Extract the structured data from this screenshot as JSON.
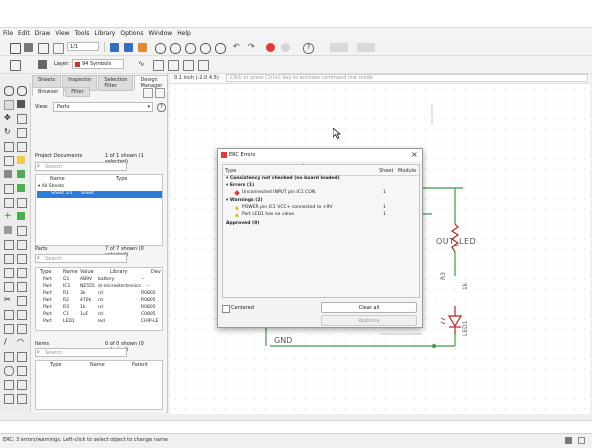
{
  "menu": [
    "File",
    "Edit",
    "Draw",
    "View",
    "Tools",
    "Library",
    "Options",
    "Window",
    "Help"
  ],
  "toolbar": {
    "sheet_value": "1/1",
    "layer_label": "Layer:",
    "layer_value": "94 Symbols",
    "layer_color": "#c0392b",
    "accent_red": "#e53935",
    "accent_blue": "#2f6fc4"
  },
  "panel": {
    "tabs": [
      "Sheets",
      "Inspector",
      "Selection Filter",
      "Design Manager"
    ],
    "subtabs": [
      "Browser",
      "Filter"
    ],
    "view_label": "View:",
    "view_value": "Parts",
    "project_docs": {
      "title": "Project Documents",
      "count": "1 of 1 shown (1 selected)",
      "search_placeholder": "Search",
      "col_name": "Name",
      "col_type": "Type",
      "root": "All Sheets",
      "item": "Sheet 1/1",
      "item_type": "Sheet"
    },
    "parts": {
      "title": "Parts",
      "count": "7 of 7 shown (0 selected)",
      "search_placeholder": "Search",
      "columns": [
        "Type",
        "Name",
        "Value",
        "Library",
        "Dev"
      ],
      "rows": [
        [
          "Part",
          "G1",
          "AB9V",
          "battery",
          "--"
        ],
        [
          "Part",
          "IC1",
          "NE555",
          "st-microelectronics",
          "--"
        ],
        [
          "Part",
          "R1",
          "3k",
          "rcl",
          "R0805"
        ],
        [
          "Part",
          "R2",
          "470k",
          "rcl",
          "R0805"
        ],
        [
          "Part",
          "R3",
          "1k",
          "rcl",
          "R0805"
        ],
        [
          "Part",
          "C1",
          "1uF",
          "rcl",
          "C0805"
        ],
        [
          "Part",
          "LED1",
          "",
          "led",
          "CHIP-LE"
        ]
      ]
    },
    "items": {
      "title": "Items",
      "count": "0 of 0 shown (0 selected)",
      "search_placeholder": "Search",
      "columns": [
        "Type",
        "Name",
        "Parent"
      ]
    }
  },
  "canvas": {
    "coords": "0.1 inch (-2.0 4.5)",
    "cmd_placeholder": "Click or press Ctrl+L key to activate command line mode",
    "net_out_led": "OUT_LED",
    "net_gnd": "GND",
    "r3_label": "R3",
    "r3_value": "1k",
    "led_label": "LED1"
  },
  "erc": {
    "title": "ERC Errors",
    "col_type": "Type",
    "col_sheet": "Sheet",
    "col_module": "Module",
    "consistency": "Consistency not checked (no board loaded)",
    "errors_header": "Errors (1)",
    "error1": "Unconnected INPUT pin IC1 CON",
    "error1_sheet": "1",
    "warnings_header": "Warnings (2)",
    "warning1": "POWER pin IC1 VCC+ connected to +9V",
    "warning1_sheet": "1",
    "warning2": "Part LED1 has no value",
    "warning2_sheet": "1",
    "approved_header": "Approved (0)",
    "centered_label": "Centered",
    "clear_all": "Clear all",
    "approve": "Approve"
  },
  "status": {
    "text": "ERC: 3 errors/warnings. Left-click to select object to change name"
  }
}
